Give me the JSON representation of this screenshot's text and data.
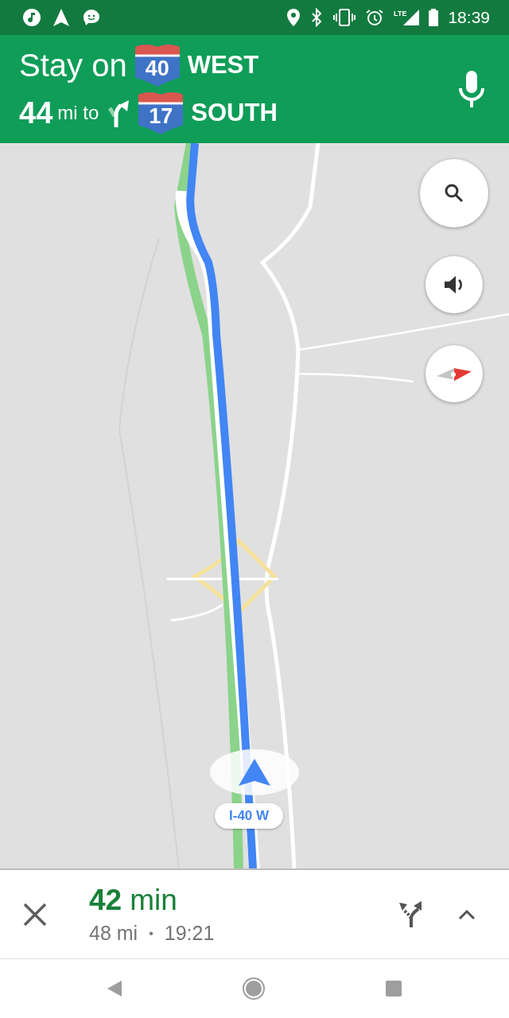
{
  "status_bar": {
    "network": "LTE",
    "time": "18:39"
  },
  "instruction": {
    "verb": "Stay on",
    "highway": "40",
    "direction": "WEST",
    "distance": "44",
    "distance_unit": "mi to",
    "next_highway": "17",
    "next_direction": "SOUTH"
  },
  "map": {
    "kind": "picture",
    "road_label": "I-40 W"
  },
  "trip": {
    "duration": "42",
    "duration_unit": "min",
    "distance": "48 mi",
    "separator": "•",
    "arrival": "19:21"
  }
}
